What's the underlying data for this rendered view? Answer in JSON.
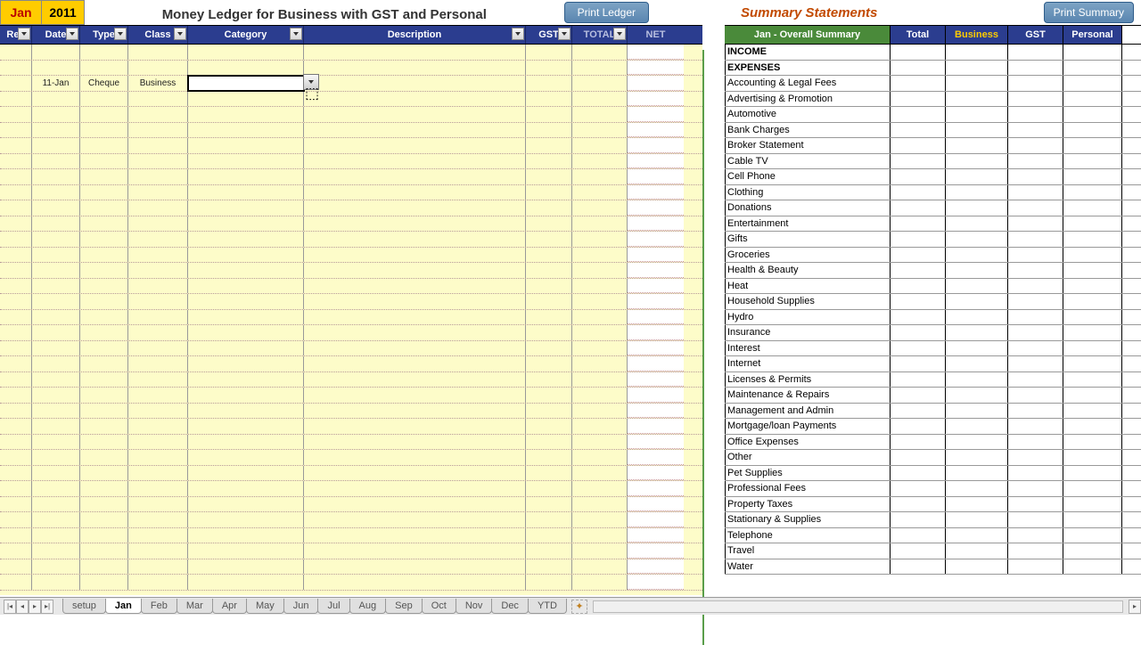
{
  "header": {
    "month": "Jan",
    "year": "2011",
    "title": "Money Ledger for Business with GST and Personal",
    "print_ledger": "Print Ledger",
    "summary_title": "Summary Statements",
    "print_summary": "Print Summary"
  },
  "columns": {
    "rec": "Rec",
    "date": "Date",
    "type": "Type",
    "class": "Class",
    "category": "Category",
    "description": "Description",
    "gst": "GST",
    "total": "TOTAL",
    "net": "NET"
  },
  "ledger_rows": [
    {
      "date": "",
      "type": "",
      "class": "",
      "category": "",
      "desc": "",
      "gst": "",
      "total": "",
      "net": ""
    },
    {
      "date": "",
      "type": "",
      "class": "",
      "category": "",
      "desc": "",
      "gst": "",
      "total": "",
      "net": ""
    },
    {
      "date": "11-Jan",
      "type": "Cheque",
      "class": "Business",
      "category": "",
      "desc": "",
      "gst": "",
      "total": "",
      "net": ""
    }
  ],
  "summary_headers": {
    "period": "Jan - Overall Summary",
    "total": "Total",
    "business": "Business",
    "gst": "GST",
    "personal": "Personal"
  },
  "summary_rows": [
    {
      "label": "INCOME",
      "bold": true
    },
    {
      "label": "EXPENSES",
      "bold": true
    },
    {
      "label": "Accounting & Legal Fees"
    },
    {
      "label": "Advertising & Promotion"
    },
    {
      "label": "Automotive"
    },
    {
      "label": "Bank Charges"
    },
    {
      "label": "Broker Statement"
    },
    {
      "label": "Cable TV"
    },
    {
      "label": "Cell Phone"
    },
    {
      "label": "Clothing"
    },
    {
      "label": "Donations"
    },
    {
      "label": "Entertainment"
    },
    {
      "label": "Gifts"
    },
    {
      "label": "Groceries"
    },
    {
      "label": "Health & Beauty"
    },
    {
      "label": "Heat"
    },
    {
      "label": "Household Supplies"
    },
    {
      "label": "Hydro"
    },
    {
      "label": "Insurance"
    },
    {
      "label": "Interest"
    },
    {
      "label": "Internet"
    },
    {
      "label": "Licenses & Permits"
    },
    {
      "label": "Maintenance & Repairs"
    },
    {
      "label": "Management and Admin"
    },
    {
      "label": "Mortgage/loan Payments"
    },
    {
      "label": "Office Expenses"
    },
    {
      "label": "Other"
    },
    {
      "label": "Pet Supplies"
    },
    {
      "label": "Professional Fees"
    },
    {
      "label": "Property Taxes"
    },
    {
      "label": "Stationary & Supplies"
    },
    {
      "label": "Telephone"
    },
    {
      "label": "Travel"
    },
    {
      "label": "Water"
    }
  ],
  "tabs": [
    "setup",
    "Jan",
    "Feb",
    "Mar",
    "Apr",
    "May",
    "Jun",
    "Jul",
    "Aug",
    "Sep",
    "Oct",
    "Nov",
    "Dec",
    "YTD"
  ],
  "active_tab": "Jan"
}
